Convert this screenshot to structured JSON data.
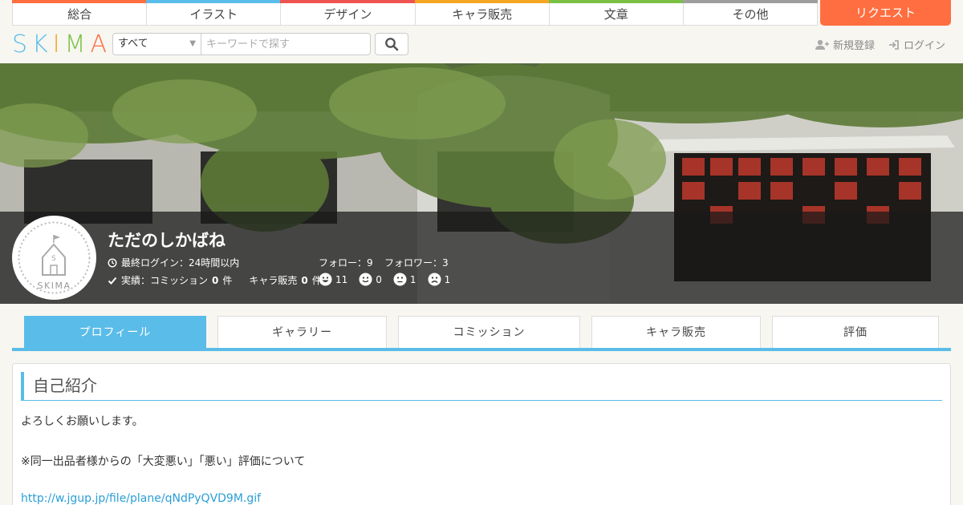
{
  "categories": [
    {
      "label": "総合",
      "color": "#ff6e40"
    },
    {
      "label": "イラスト",
      "color": "#5abce8"
    },
    {
      "label": "デザイン",
      "color": "#ef5350"
    },
    {
      "label": "キャラ販売",
      "color": "#f5a623"
    },
    {
      "label": "文章",
      "color": "#7bc043"
    },
    {
      "label": "その他",
      "color": "#9e9e9e"
    }
  ],
  "request_label": "リクエスト",
  "logo": {
    "letters": [
      "S",
      "K",
      "I",
      "M",
      "A"
    ],
    "colors": [
      "#5abce8",
      "#5abce8",
      "#f5a623",
      "#7bc043",
      "#ff6e40"
    ]
  },
  "search": {
    "category": "すべて",
    "placeholder": "キーワードで探す",
    "icon": "search-icon"
  },
  "header_links": {
    "signup": "新規登録",
    "login": "ログイン"
  },
  "profile": {
    "name": "ただのしかばね",
    "last_login": "最終ログイン：24時間以内",
    "follow": "フォロー：9",
    "followers": "フォロワー：3",
    "record_prefix": "実績：コミッション",
    "commission_count": "0",
    "count_suffix": "件",
    "chara_label": "キャラ販売",
    "chara_count": "0",
    "ratings": [
      {
        "icon": "very-good-face-icon",
        "count": "11"
      },
      {
        "icon": "good-face-icon",
        "count": "0"
      },
      {
        "icon": "bad-face-icon",
        "count": "1"
      },
      {
        "icon": "very-bad-face-icon",
        "count": "1"
      }
    ],
    "avatar_text": "SKIMA"
  },
  "tabs": [
    "プロフィール",
    "ギャラリー",
    "コミッション",
    "キャラ販売",
    "評価"
  ],
  "section": {
    "title": "自己紹介",
    "lines": [
      "よろしくお願いします。",
      "※同一出品者様からの「大変悪い」「悪い」評価について"
    ],
    "link": "http://w.jgup.jp/file/plane/qNdPyQVD9M.gif"
  },
  "accent": "#5abce8"
}
